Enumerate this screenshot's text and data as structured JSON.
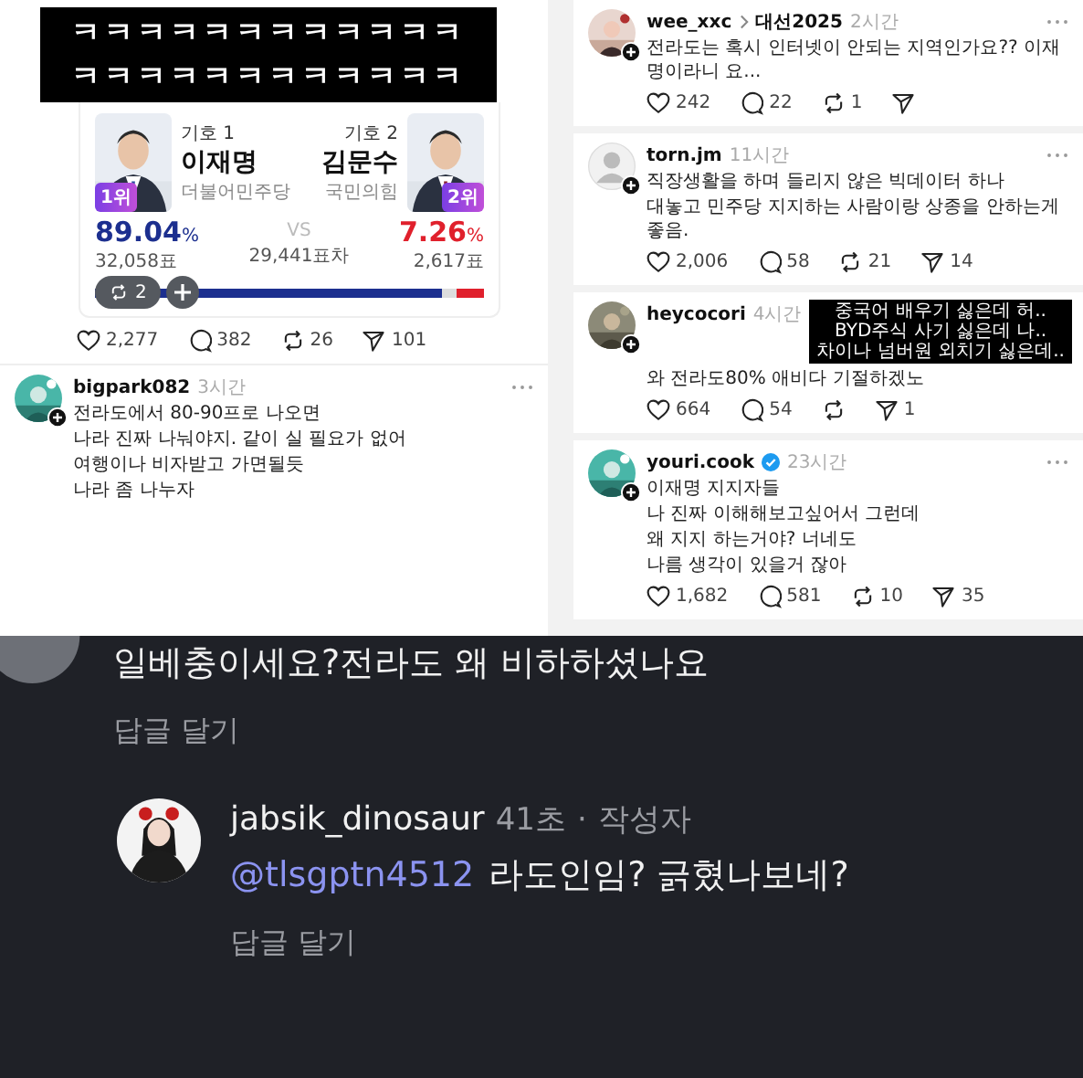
{
  "left_column": {
    "overlay_text": [
      "ㅋㅋㅋㅋㅋㅋㅋㅋㅋㅋㅋㅋ",
      "ㅋㅋㅋㅋㅋㅋㅋㅋㅋㅋㅋㅋ"
    ],
    "election_card": {
      "candidates": [
        {
          "number_label": "기호 1",
          "name": "이재명",
          "party": "더불어민주당",
          "rank": "1위",
          "percent": "89.04",
          "unit": "%",
          "votes": "32,058표",
          "color": "#1c2f8f"
        },
        {
          "number_label": "기호 2",
          "name": "김문수",
          "party": "국민의힘",
          "rank": "2위",
          "percent": "7.26",
          "unit": "%",
          "votes": "2,617표",
          "color": "#e0202c"
        }
      ],
      "vs": "VS",
      "margin": "29,441표차",
      "bar": [
        {
          "level": 0.89
        },
        {
          "level": 0.07
        }
      ],
      "overlay_buttons": [
        {
          "kind": "repost",
          "label": "2"
        },
        {
          "kind": "add"
        }
      ]
    },
    "stats": [
      {
        "kind": "like",
        "count": "2,277"
      },
      {
        "kind": "comment",
        "count": "382"
      },
      {
        "kind": "repost",
        "count": "26"
      },
      {
        "kind": "share",
        "count": "101"
      }
    ],
    "post": {
      "avatar": {
        "kind": "picture"
      },
      "username": "bigpark082",
      "time": "3시간",
      "menu": true,
      "lines": [
        "전라도에서 80-90프로 나오면",
        "나라 진짜 나눠야지. 같이 실 필요가 없어",
        "여행이나 비자받고 가면될듯",
        "나라 좀 나누자"
      ]
    }
  },
  "right_column": {
    "posts": [
      {
        "avatar": {
          "kind": "picture"
        },
        "username": "wee_xxc",
        "channel": "대선2025",
        "time": "2시간",
        "menu": true,
        "verified": false,
        "lines": [
          "전라도는 혹시 인터넷이 안되는 지역인가요?? 이재명이라니 요..."
        ],
        "stats": [
          {
            "kind": "like",
            "count": "242"
          },
          {
            "kind": "comment",
            "count": "22"
          },
          {
            "kind": "repost",
            "count": "1"
          },
          {
            "kind": "share"
          }
        ]
      },
      {
        "avatar": {
          "kind": "default"
        },
        "username": "torn.jm",
        "time": "11시간",
        "menu": true,
        "verified": false,
        "lines": [
          "직장생활을 하며 들리지 않은 빅데이터 하나",
          "대놓고 민주당 지지하는 사람이랑 상종을 안하는게 좋음."
        ],
        "stats": [
          {
            "kind": "like",
            "count": "2,006"
          },
          {
            "kind": "comment",
            "count": "58"
          },
          {
            "kind": "repost",
            "count": "21"
          },
          {
            "kind": "share",
            "count": "14"
          }
        ]
      },
      {
        "avatar": {
          "kind": "picture"
        },
        "username": "heycocori",
        "time": "4시간",
        "menu": false,
        "verified": false,
        "lines": [
          "와 전라도80% 애비다 기절하겠노"
        ],
        "overlay_caption": [
          "중국어 배우기 싫은데 허..",
          "BYD주식 사기 싫은데 나..",
          "차이나 넘버원 외치기 싫은데.."
        ],
        "stats": [
          {
            "kind": "like",
            "count": "664"
          },
          {
            "kind": "comment",
            "count": "54"
          },
          {
            "kind": "repost"
          },
          {
            "kind": "share",
            "count": "1"
          }
        ]
      },
      {
        "avatar": {
          "kind": "picture"
        },
        "username": "youri.cook",
        "time": "23시간",
        "menu": true,
        "verified": true,
        "lines": [
          "이재명 지지자들",
          "나 진짜 이해해보고싶어서 그런데",
          "왜 지지 하는거야? 너네도",
          "나름 생각이 있을거 잖아"
        ],
        "stats": [
          {
            "kind": "like",
            "count": "1,682"
          },
          {
            "kind": "comment",
            "count": "581"
          },
          {
            "kind": "repost",
            "count": "10"
          },
          {
            "kind": "share",
            "count": "35"
          }
        ]
      }
    ]
  },
  "dark_thread": {
    "comment": {
      "text": "일베충이세요?전라도 왜 비하하셨나요",
      "reply_label": "답글 달기"
    },
    "reply": {
      "username": "jabsik_dinosaur",
      "time": "41초",
      "separator": "·",
      "author_badge": "작성자",
      "mention": "@tlsgptn4512",
      "text": "라도인임? 긁혔나보네?",
      "reply_label": "답글 달기"
    }
  }
}
